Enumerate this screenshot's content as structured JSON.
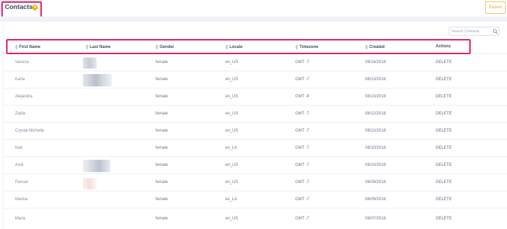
{
  "header": {
    "title": "Contacts",
    "count": "4",
    "export_label": "Export"
  },
  "search": {
    "placeholder": "Search Contacts"
  },
  "columns": [
    "First Name",
    "Last Name",
    "Gender",
    "Locale",
    "Timezone",
    "Created",
    "Actions"
  ],
  "rows": [
    {
      "first": "Vanesa",
      "gender": "female",
      "locale": "en_US",
      "timezone": "GMT -7",
      "created": "08/14/2018",
      "action": "DELETE"
    },
    {
      "first": "Karla",
      "gender": "female",
      "locale": "en_US",
      "timezone": "GMT -7",
      "created": "08/13/2018",
      "action": "DELETE"
    },
    {
      "first": "Alejandra",
      "gender": "female",
      "locale": "en_US",
      "timezone": "GMT -8",
      "created": "08/13/2018",
      "action": "DELETE"
    },
    {
      "first": "Zaida",
      "gender": "female",
      "locale": "en_US",
      "timezone": "GMT -7",
      "created": "08/12/2018",
      "action": "DELETE"
    },
    {
      "first": "Crystal Michelle",
      "gender": "female",
      "locale": "en_US",
      "timezone": "GMT -7",
      "created": "08/12/2018",
      "action": "DELETE"
    },
    {
      "first": "Nati",
      "gender": "female",
      "locale": "es_LA",
      "timezone": "GMT -7",
      "created": "08/10/2018",
      "action": "DELETE"
    },
    {
      "first": "Andi",
      "gender": "female",
      "locale": "en_US",
      "timezone": "GMT -7",
      "created": "08/10/2018",
      "action": "DELETE"
    },
    {
      "first": "Panual",
      "gender": "female",
      "locale": "en_US",
      "timezone": "GMT -7",
      "created": "08/09/2018",
      "action": "DELETE"
    },
    {
      "first": "Marina",
      "gender": "female",
      "locale": "es_LA",
      "timezone": "GMT -7",
      "created": "08/09/2018",
      "action": "DELETE"
    },
    {
      "first": "Maria",
      "gender": "female",
      "locale": "en_US",
      "timezone": "GMT -7",
      "created": "08/07/2018",
      "action": "DELETE"
    }
  ],
  "colors": {
    "highlight": "#e8175d",
    "badge": "#f0b400",
    "export": "#e2a52b"
  },
  "icons": {
    "sort": "sort-icon",
    "search": "search-icon"
  }
}
